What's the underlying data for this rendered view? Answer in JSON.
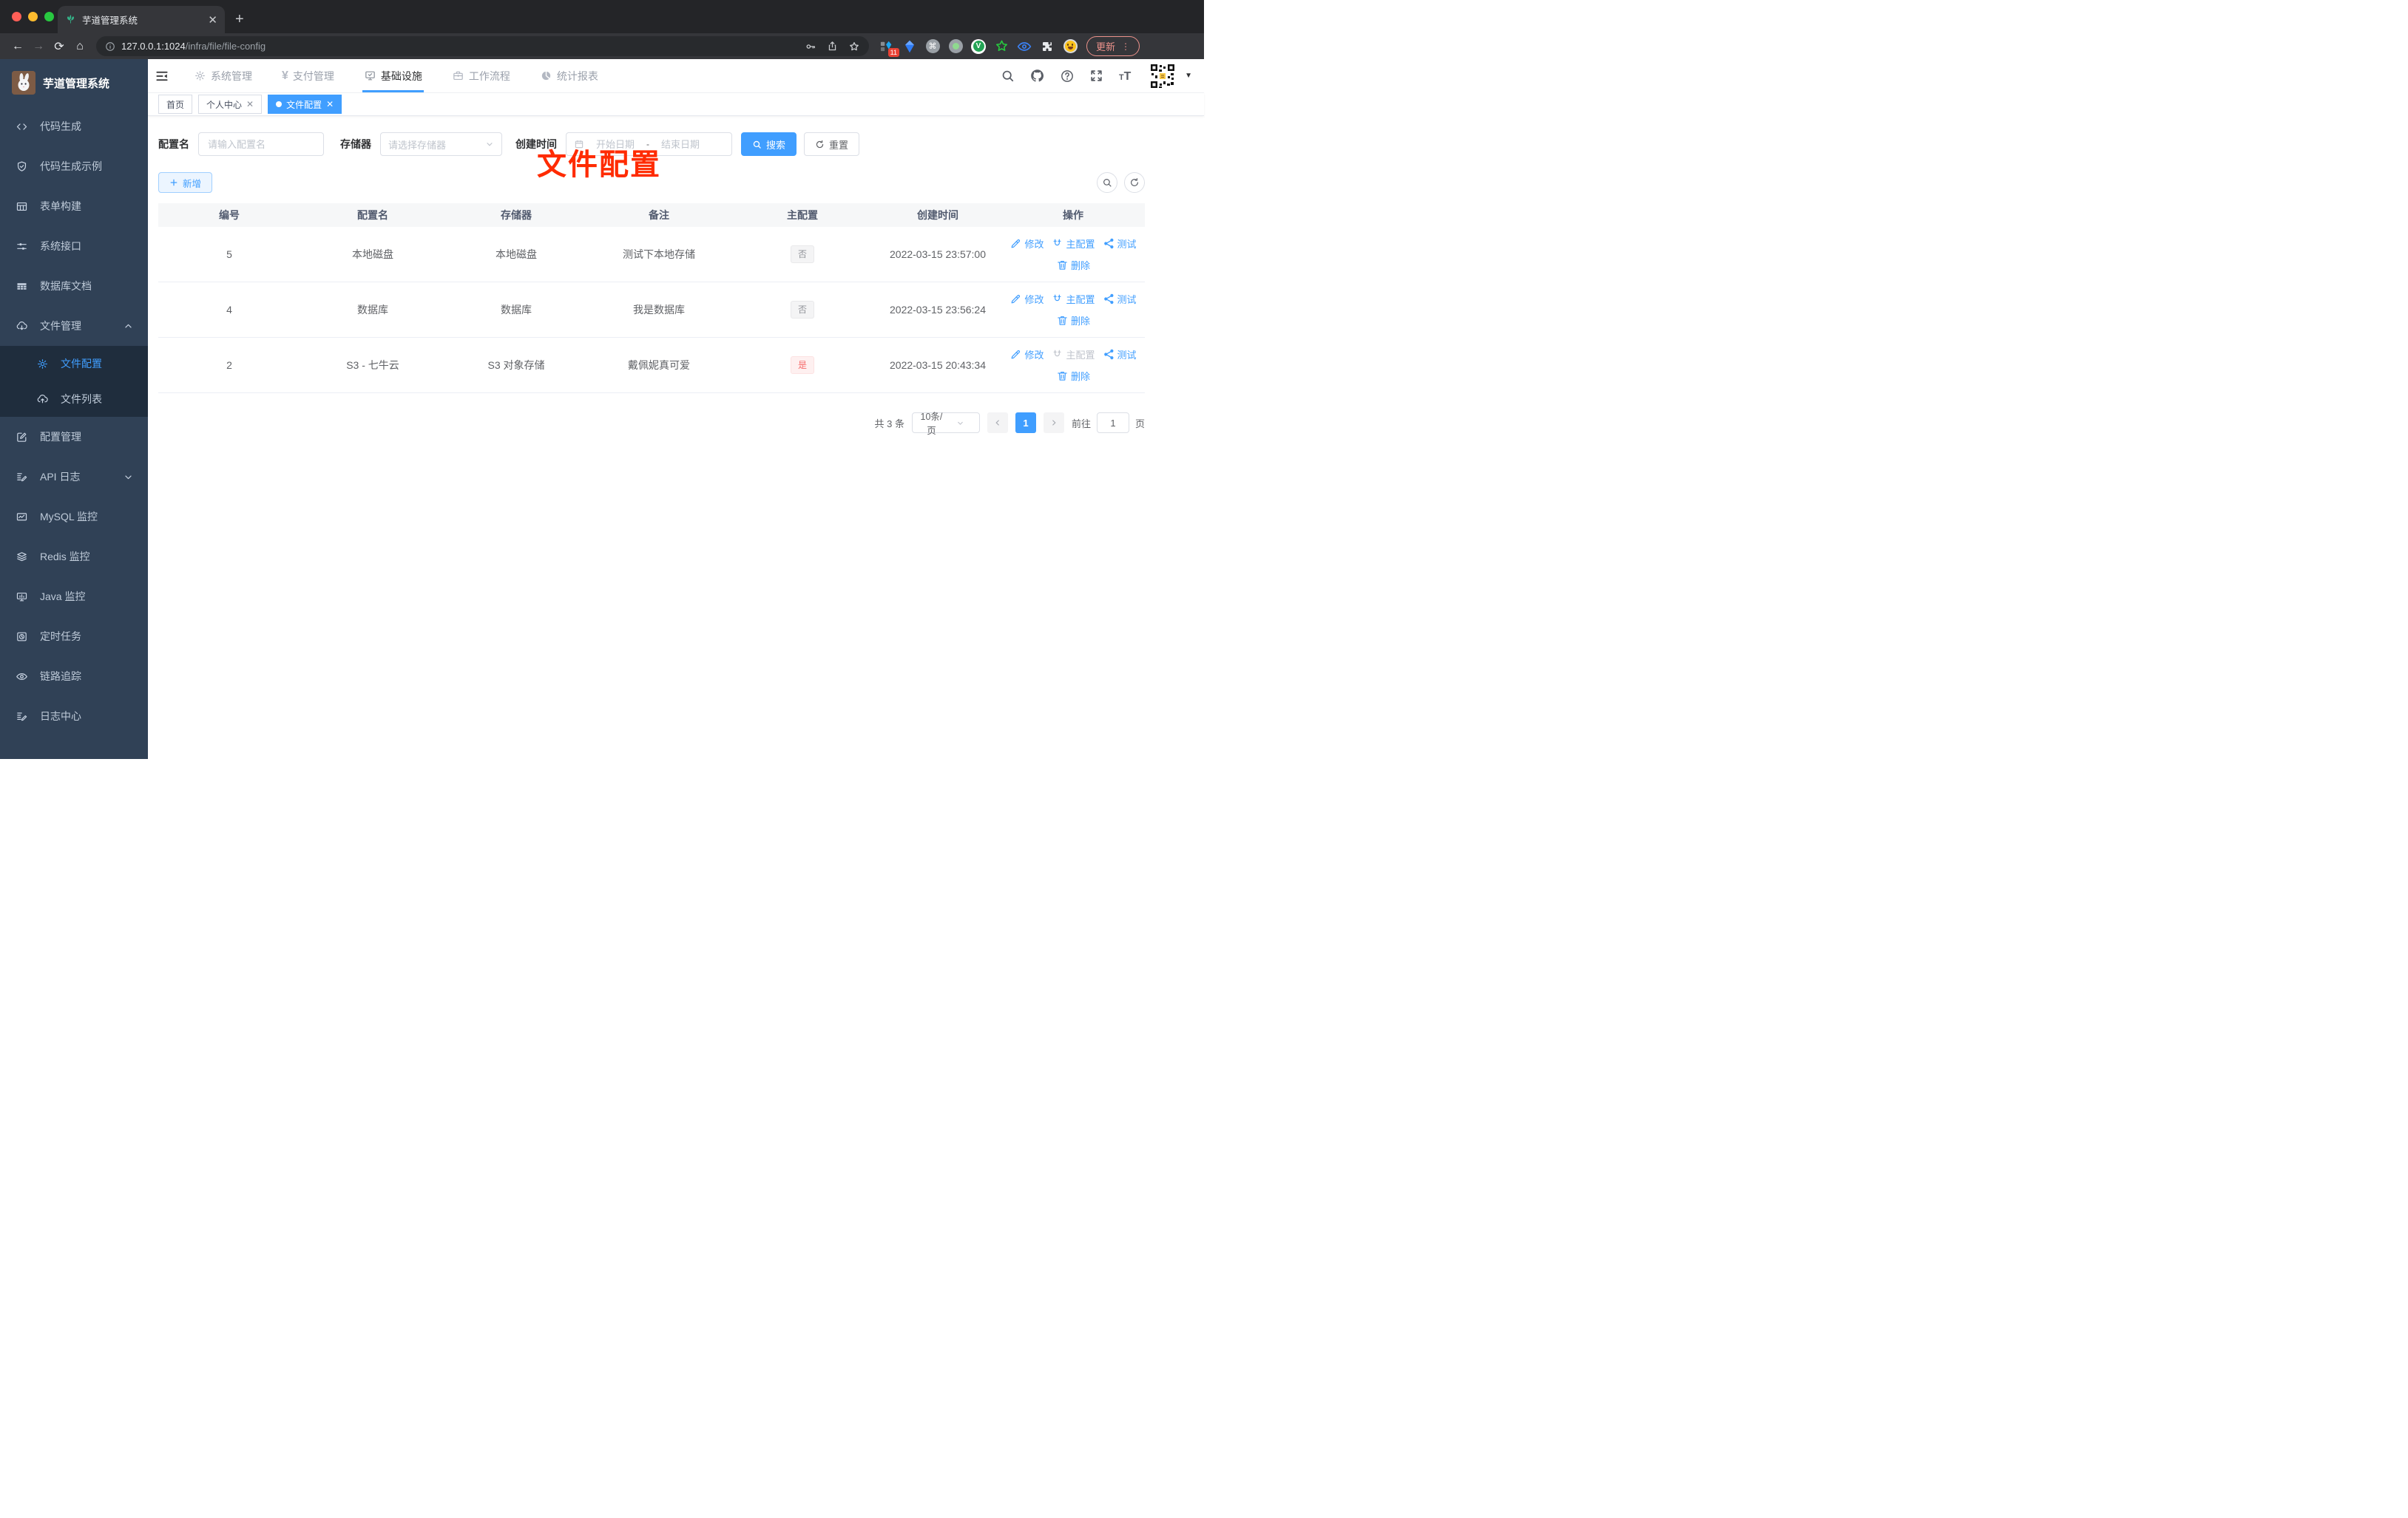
{
  "browser": {
    "tab_title": "芋道管理系统",
    "url_host": "127.0.0.1:1024",
    "url_path": "/infra/file/file-config",
    "update_label": "更新",
    "extension_badge": "11",
    "extensions": [
      "pin-extension-icon",
      "kite-extension-icon",
      "command-extension-icon",
      "record-extension-icon",
      "v-extension-icon",
      "star-extension-icon",
      "eye-extension-icon",
      "puzzle-extension-icon",
      "emoji-extension-icon"
    ]
  },
  "sidebar": {
    "logo_title": "芋道管理系统",
    "items": [
      {
        "label": "代码生成",
        "icon": "code-icon"
      },
      {
        "label": "代码生成示例",
        "icon": "shield-check-icon"
      },
      {
        "label": "表单构建",
        "icon": "form-icon"
      },
      {
        "label": "系统接口",
        "icon": "sliders-icon"
      },
      {
        "label": "数据库文档",
        "icon": "grid-icon"
      },
      {
        "label": "文件管理",
        "icon": "cloud-download-icon",
        "expanded": true
      },
      {
        "label": "文件配置",
        "icon": "gear-icon",
        "sub": true,
        "active": true
      },
      {
        "label": "文件列表",
        "icon": "cloud-upload-icon",
        "sub": true
      },
      {
        "label": "配置管理",
        "icon": "edit-square-icon"
      },
      {
        "label": "API 日志",
        "icon": "doc-edit-icon",
        "collapsed": true
      },
      {
        "label": "MySQL 监控",
        "icon": "chart-icon"
      },
      {
        "label": "Redis 监控",
        "icon": "layers-icon"
      },
      {
        "label": "Java 监控",
        "icon": "monitor-icon"
      },
      {
        "label": "定时任务",
        "icon": "timer-icon"
      },
      {
        "label": "链路追踪",
        "icon": "eye-icon"
      },
      {
        "label": "日志中心",
        "icon": "doc-edit-icon"
      }
    ]
  },
  "topnav": {
    "items": [
      {
        "label": "系统管理",
        "icon": "gear-icon"
      },
      {
        "label": "支付管理",
        "icon": "yen-icon"
      },
      {
        "label": "基础设施",
        "icon": "monitor-check-icon",
        "active": true
      },
      {
        "label": "工作流程",
        "icon": "briefcase-icon"
      },
      {
        "label": "统计报表",
        "icon": "pie-icon"
      }
    ]
  },
  "tags": [
    {
      "label": "首页",
      "closable": false,
      "active": false
    },
    {
      "label": "个人中心",
      "closable": true,
      "active": false
    },
    {
      "label": "文件配置",
      "closable": true,
      "active": true
    }
  ],
  "annotation": {
    "text": "文件配置"
  },
  "filters": {
    "name_label": "配置名",
    "name_placeholder": "请输入配置名",
    "storage_label": "存储器",
    "storage_placeholder": "请选择存储器",
    "date_label": "创建时间",
    "date_start_placeholder": "开始日期",
    "date_separator": "-",
    "date_end_placeholder": "结束日期",
    "search_label": "搜索",
    "reset_label": "重置"
  },
  "toolbar": {
    "add_label": "新增"
  },
  "table": {
    "columns": [
      "编号",
      "配置名",
      "存储器",
      "备注",
      "主配置",
      "创建时间",
      "操作"
    ],
    "actions": {
      "edit": "修改",
      "master": "主配置",
      "test": "测试",
      "delete": "删除"
    },
    "rows": [
      {
        "id": "5",
        "name": "本地磁盘",
        "storage": "本地磁盘",
        "remark": "测试下本地存储",
        "master": "否",
        "master_type": "info",
        "created": "2022-03-15 23:57:00",
        "master_disabled": false
      },
      {
        "id": "4",
        "name": "数据库",
        "storage": "数据库",
        "remark": "我是数据库",
        "master": "否",
        "master_type": "info",
        "created": "2022-03-15 23:56:24",
        "master_disabled": false
      },
      {
        "id": "2",
        "name": "S3 - 七牛云",
        "storage": "S3 对象存储",
        "remark": "戴佩妮真可爱",
        "master": "是",
        "master_type": "danger",
        "created": "2022-03-15 20:43:34",
        "master_disabled": true
      }
    ]
  },
  "pagination": {
    "total_label": "共 3 条",
    "page_size": "10条/页",
    "current_page": "1",
    "goto_label": "前往",
    "goto_value": "1",
    "page_unit": "页"
  },
  "colors": {
    "accent": "#409eff",
    "danger": "#f56c6c",
    "annotation": "#ff2b00"
  }
}
